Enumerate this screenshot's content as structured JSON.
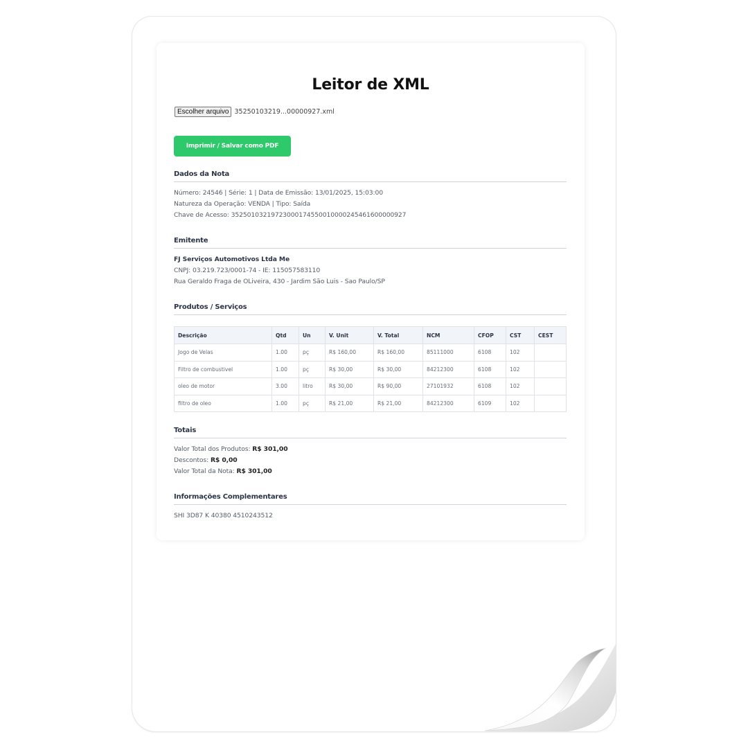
{
  "title": "Leitor de XML",
  "file_input": {
    "button_label": "Escolher arquivo",
    "file_name": "35250103219...00000927.xml"
  },
  "print_button": "Imprimir / Salvar como PDF",
  "sections": {
    "nota": {
      "heading": "Dados da Nota",
      "line1": "Número: 24546 | Série: 1 | Data de Emissão: 13/01/2025, 15:03:00",
      "line2": "Natureza da Operação: VENDA | Tipo: Saída",
      "line3": "Chave de Acesso: 35250103219723000174550010000245461600000927"
    },
    "emitente": {
      "heading": "Emitente",
      "name": "FJ Serviços Automotivos Ltda Me",
      "line1": "CNPJ: 03.219.723/0001-74 - IE: 115057583110",
      "line2": "Rua Geraldo Fraga de OLiveira, 430 - Jardim São Luis - Sao Paulo/SP"
    },
    "produtos": {
      "heading": "Produtos / Serviços",
      "columns": [
        "Descrição",
        "Qtd",
        "Un",
        "V. Unit",
        "V. Total",
        "NCM",
        "CFOP",
        "CST",
        "CEST"
      ],
      "rows": [
        [
          "Jogo de Velas",
          "1.00",
          "pç",
          "R$ 160,00",
          "R$ 160,00",
          "85111000",
          "6108",
          "102",
          ""
        ],
        [
          "Filtro de combustivel",
          "1.00",
          "pç",
          "R$ 30,00",
          "R$ 30,00",
          "84212300",
          "6108",
          "102",
          ""
        ],
        [
          "oleo de motor",
          "3.00",
          "litro",
          "R$ 30,00",
          "R$ 90,00",
          "27101932",
          "6108",
          "102",
          ""
        ],
        [
          "filtro de oleo",
          "1.00",
          "pç",
          "R$ 21,00",
          "R$ 21,00",
          "84212300",
          "6109",
          "102",
          ""
        ]
      ]
    },
    "totais": {
      "heading": "Totais",
      "produtos_label": "Valor Total dos Produtos:",
      "produtos_value": "R$ 301,00",
      "descontos_label": "Descontos:",
      "descontos_value": "R$ 0,00",
      "nota_label": "Valor Total da Nota:",
      "nota_value": "R$ 301,00"
    },
    "info": {
      "heading": "Informações Complementares",
      "text": "SHI 3D87 K 40380 4510243512"
    }
  },
  "colors": {
    "accent_green": "#2ec96a",
    "heading_text": "#2b3445"
  }
}
